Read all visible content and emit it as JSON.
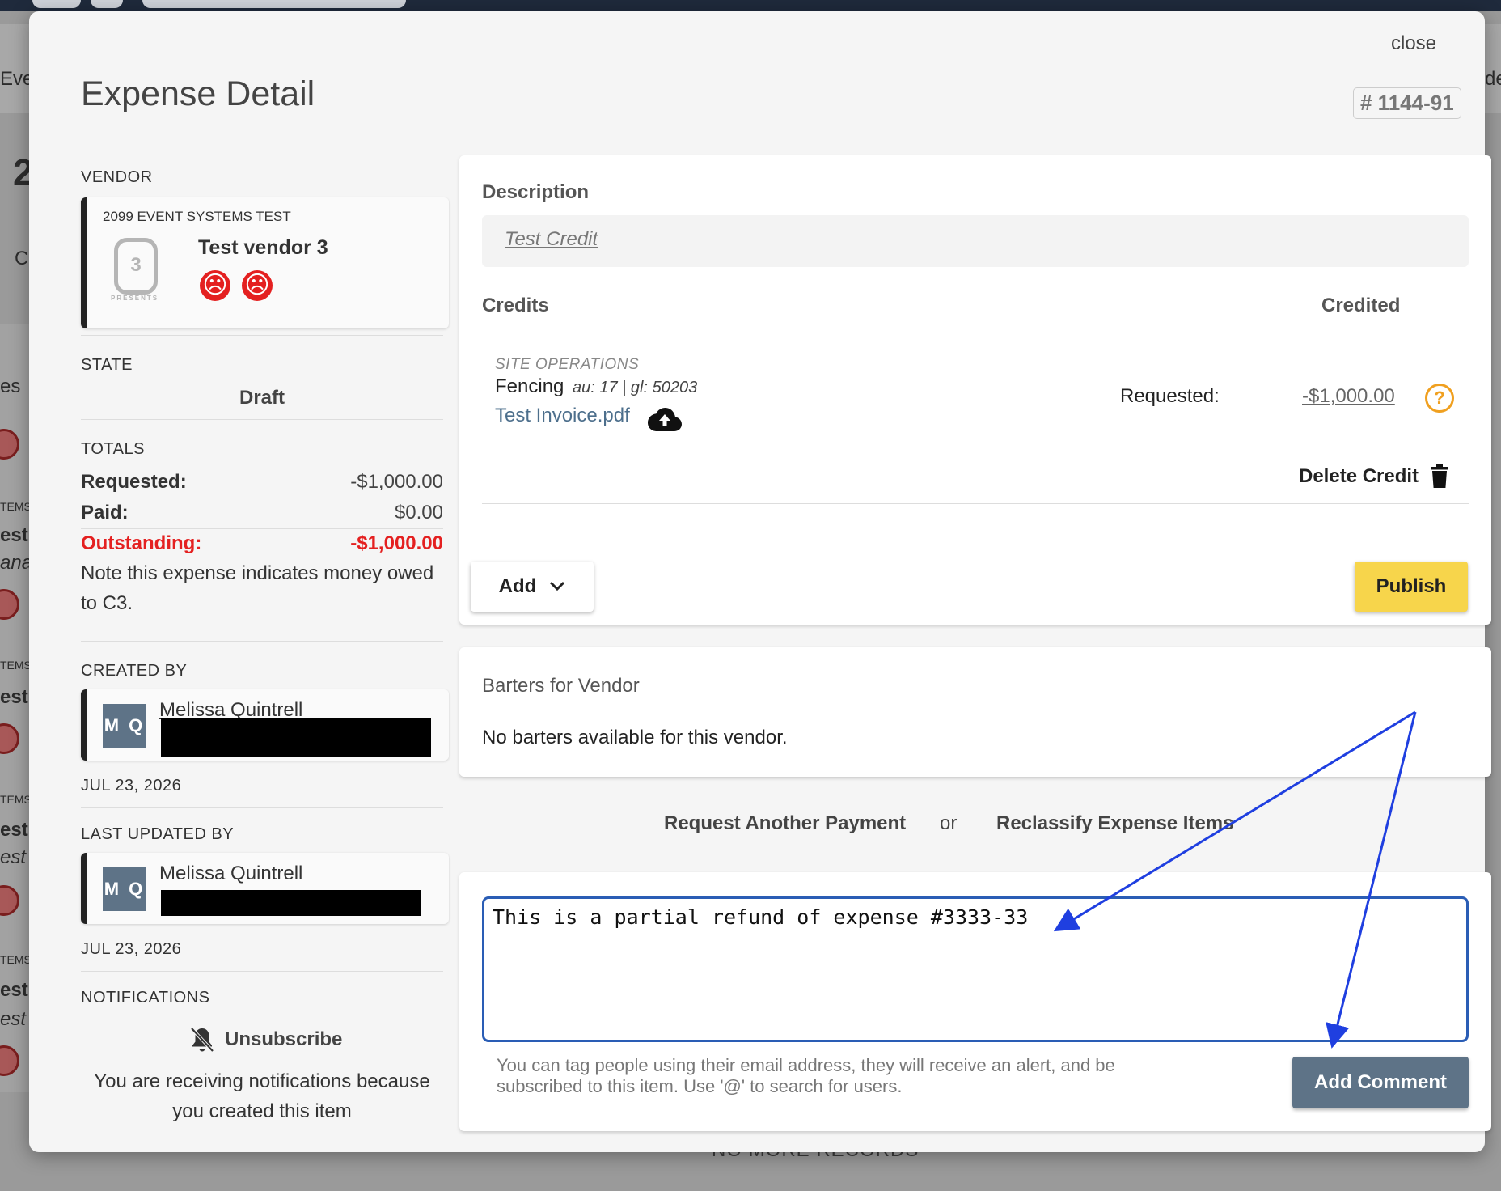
{
  "background": {
    "header_left": "Eve",
    "header_right": "de",
    "left_fragments": [
      "es",
      "TEMS",
      "est $",
      "ana",
      "TEMS",
      "est V",
      "TEMS",
      "est V",
      "est (",
      "TEMS",
      "est v",
      "est"
    ],
    "big_digit": "2",
    "hash_fragment": "#",
    "c_fragment": "Co",
    "footer": "NO MORE RECORDS"
  },
  "modal": {
    "close_label": "close",
    "title": "Expense Detail",
    "expense_number": "# 1144-91"
  },
  "vendor": {
    "section_label": "VENDOR",
    "org": "2099 EVENT SYSTEMS TEST",
    "logo_letter": "3",
    "logo_caption": "PRESENTS",
    "name": "Test vendor 3",
    "ratings": [
      "sad-face",
      "sad-face"
    ]
  },
  "state": {
    "section_label": "STATE",
    "value": "Draft"
  },
  "totals": {
    "section_label": "TOTALS",
    "requested_label": "Requested:",
    "requested_value": "-$1,000.00",
    "paid_label": "Paid:",
    "paid_value": "$0.00",
    "outstanding_label": "Outstanding:",
    "outstanding_value": "-$1,000.00",
    "note": "Note this expense indicates money owed to C3."
  },
  "created_by": {
    "section_label": "CREATED BY",
    "initials": "M Q",
    "name": "Melissa Quintrell",
    "date": "JUL 23, 2026"
  },
  "last_updated_by": {
    "section_label": "LAST UPDATED BY",
    "initials": "M Q",
    "name": "Melissa Quintrell",
    "date": "JUL 23, 2026"
  },
  "notifications": {
    "section_label": "NOTIFICATIONS",
    "unsubscribe_label": "Unsubscribe",
    "note": "You are receiving notifications because you created this item"
  },
  "description": {
    "label": "Description",
    "value": "Test Credit"
  },
  "credits": {
    "label": "Credits",
    "credited_label": "Credited",
    "items": [
      {
        "department": "SITE OPERATIONS",
        "name": "Fencing",
        "meta": "au: 17 | gl: 50203",
        "attachment": "Test Invoice.pdf",
        "requested_label": "Requested:",
        "requested_value": "-$1,000.00"
      }
    ],
    "delete_label": "Delete Credit",
    "add_label": "Add",
    "publish_label": "Publish"
  },
  "barters": {
    "title": "Barters for Vendor",
    "empty_text": "No barters available for this vendor."
  },
  "actions": {
    "request_payment": "Request Another Payment",
    "or": "or",
    "reclassify": "Reclassify Expense Items"
  },
  "comment": {
    "value": "This is a partial refund of expense #3333-33",
    "help_text": "You can tag people using their email address, they will receive an alert, and be subscribed to this item. Use '@' to search for users.",
    "submit_label": "Add Comment"
  },
  "colors": {
    "accent_blue": "#2a5db5",
    "publish_yellow": "#f7d54b",
    "danger_red": "#e42020",
    "slate_button": "#5e7387",
    "annotation_arrow": "#1f3fe0"
  }
}
